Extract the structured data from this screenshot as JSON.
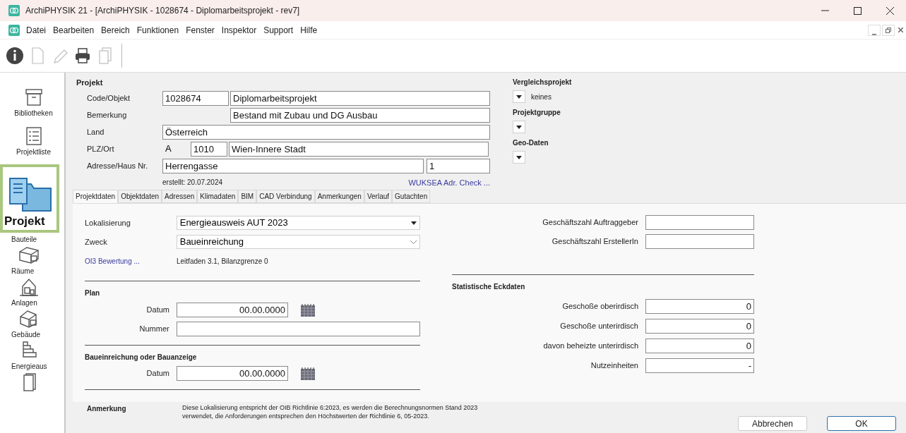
{
  "window": {
    "title": "ArchiPHYSIK 21 - [ArchiPHYSIK - 1028674 - Diplomarbeitsprojekt - rev7]"
  },
  "menu": [
    "Datei",
    "Bearbeiten",
    "Bereich",
    "Funktionen",
    "Fenster",
    "Inspektor",
    "Support",
    "Hilfe"
  ],
  "toolbar": [
    {
      "kind": "info",
      "disabled": false
    },
    {
      "kind": "new",
      "disabled": true
    },
    {
      "kind": "edit",
      "disabled": true
    },
    {
      "kind": "print",
      "disabled": false
    },
    {
      "kind": "copy",
      "disabled": true
    }
  ],
  "sidebar": {
    "items": [
      {
        "label": "Bibliotheken",
        "selected": false,
        "kind": "archive"
      },
      {
        "label": "Projektliste",
        "selected": false,
        "kind": "list"
      },
      {
        "label": "Projekt",
        "selected": true,
        "kind": "folder"
      },
      {
        "label": "Bauteile",
        "selected": false,
        "kind": "none"
      },
      {
        "label": "Räume",
        "selected": false,
        "kind": "box"
      },
      {
        "label": "Anlagen",
        "selected": false,
        "kind": "house"
      },
      {
        "label": "Gebäude",
        "selected": false,
        "kind": "building"
      },
      {
        "label": "Energieaus",
        "selected": false,
        "kind": "steps"
      }
    ]
  },
  "project": {
    "heading": "Projekt",
    "code_label": "Code/Objekt",
    "code": "1028674",
    "object": "Diplomarbeitsprojekt",
    "remark_label": "Bemerkung",
    "remark": "Bestand mit Zubau und DG Ausbau",
    "country_label": "Land",
    "country": "Österreich",
    "zip_label": "PLZ/Ort",
    "country_code": "A",
    "zip": "1010",
    "city": "Wien-Innere Stadt",
    "address_label": "Adresse/Haus Nr.",
    "street": "Herrengasse",
    "house_no": "1",
    "created": "erstellt: 20.07.2024",
    "check_link": "WUKSEA Adr. Check ..."
  },
  "side_options": [
    {
      "heading": "Vergleichsprojekt",
      "value": "keines"
    },
    {
      "heading": "Projektgruppe"
    },
    {
      "heading": "Geo-Daten"
    }
  ],
  "tabs": [
    {
      "label": "Projektdaten",
      "selected": true
    },
    {
      "label": "Objektdaten",
      "selected": false
    },
    {
      "label": "Adressen",
      "selected": false
    },
    {
      "label": "Klimadaten",
      "selected": false
    },
    {
      "label": "BIM",
      "selected": false
    },
    {
      "label": "CAD Verbindung",
      "selected": false
    },
    {
      "label": "Anmerkungen",
      "selected": false
    },
    {
      "label": "Verlauf",
      "selected": false
    },
    {
      "label": "Gutachten",
      "selected": false
    }
  ],
  "panel": {
    "localization_label": "Lokalisierung",
    "localization": "Energieausweis AUT 2023",
    "purpose_label": "Zweck",
    "purpose": "Baueinreichung",
    "oi3_link": "OI3 Bewertung ...",
    "oi3_text": "Leitfaden 3.1, Bilanzgrenze 0",
    "reference_fields": [
      {
        "label": "Geschäftszahl Auftraggeber"
      },
      {
        "label": "Geschäftszahl ErstellerIn"
      }
    ],
    "plan_heading": "Plan",
    "plan_date_label": "Datum",
    "plan_date": "00.00.0000",
    "plan_number_label": "Nummer",
    "submission_heading": "Baueinreichung oder Bauanzeige",
    "submission_date_label": "Datum",
    "submission_date": "00.00.0000",
    "stats_heading": "Statistische Eckdaten",
    "stats": [
      {
        "label": "Geschoße oberirdisch",
        "value": "0"
      },
      {
        "label": "Geschoße unterirdisch",
        "value": "0"
      },
      {
        "label": "davon beheizte unterirdisch",
        "value": "0"
      },
      {
        "label": "Nutzeinheiten",
        "value": "-"
      }
    ]
  },
  "footer": {
    "heading": "Anmerkung",
    "text": "Diese Lokalisierung entspricht der OIB Richtlinie 6:2023, es werden die Berechnungsnormen Stand 2023 verwendet, die Anforderungen entsprechen den Höchstwerten der Richtlinie 6, 05-2023.",
    "buttons": [
      "Abbrechen",
      "OK"
    ]
  }
}
